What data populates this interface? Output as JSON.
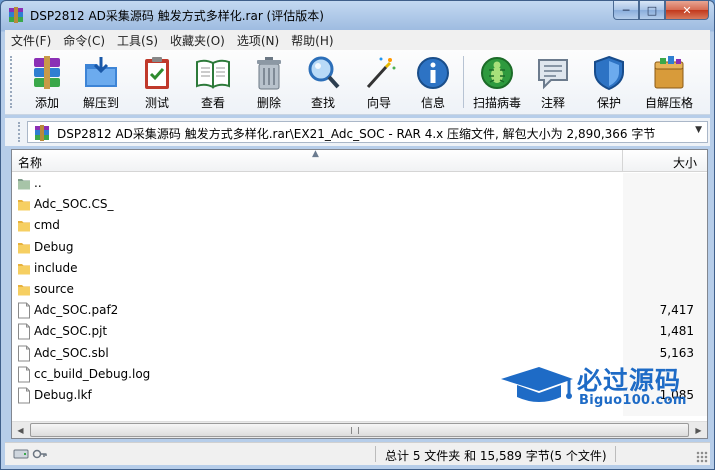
{
  "window": {
    "title": "DSP2812 AD采集源码 触发方式多样化.rar (评估版本)",
    "controls": {
      "minimize": "─",
      "maximize": "□",
      "close": "✕"
    }
  },
  "menu": [
    "文件(F)",
    "命令(C)",
    "工具(S)",
    "收藏夹(O)",
    "选项(N)",
    "帮助(H)"
  ],
  "toolbar": {
    "add": "添加",
    "extract_to": "解压到",
    "test": "测试",
    "view": "查看",
    "delete": "删除",
    "find": "查找",
    "wizard": "向导",
    "info": "信息",
    "virus_scan": "扫描病毒",
    "comment": "注释",
    "protect": "保护",
    "sfx": "自解压格"
  },
  "address": {
    "path": "DSP2812 AD采集源码 触发方式多样化.rar\\EX21_Adc_SOC - RAR 4.x 压缩文件, 解包大小为 2,890,366 字节"
  },
  "list": {
    "col_name": "名称",
    "col_size": "大小",
    "rows": [
      {
        "name": "..",
        "size": "",
        "icon": "parent-folder-icon"
      },
      {
        "name": "Adc_SOC.CS_",
        "size": "",
        "icon": "folder-icon"
      },
      {
        "name": "cmd",
        "size": "",
        "icon": "folder-icon"
      },
      {
        "name": "Debug",
        "size": "",
        "icon": "folder-icon"
      },
      {
        "name": "include",
        "size": "",
        "icon": "folder-icon"
      },
      {
        "name": "source",
        "size": "",
        "icon": "folder-icon"
      },
      {
        "name": "Adc_SOC.paf2",
        "size": "7,417",
        "icon": "file-icon"
      },
      {
        "name": "Adc_SOC.pjt",
        "size": "1,481",
        "icon": "file-icon"
      },
      {
        "name": "Adc_SOC.sbl",
        "size": "5,163",
        "icon": "file-icon"
      },
      {
        "name": "cc_build_Debug.log",
        "size": "",
        "icon": "file-icon"
      },
      {
        "name": "Debug.lkf",
        "size": "1,085",
        "icon": "file-icon"
      }
    ]
  },
  "status": {
    "text": "总计 5 文件夹 和 15,589 字节(5 个文件)"
  },
  "watermark": {
    "title": "必过源码",
    "subtitle": "Biguo100.com"
  },
  "colors": {
    "accent": "#1e6bc6",
    "folder": "#f2c04a",
    "title_bar": "#c3d9f1"
  }
}
